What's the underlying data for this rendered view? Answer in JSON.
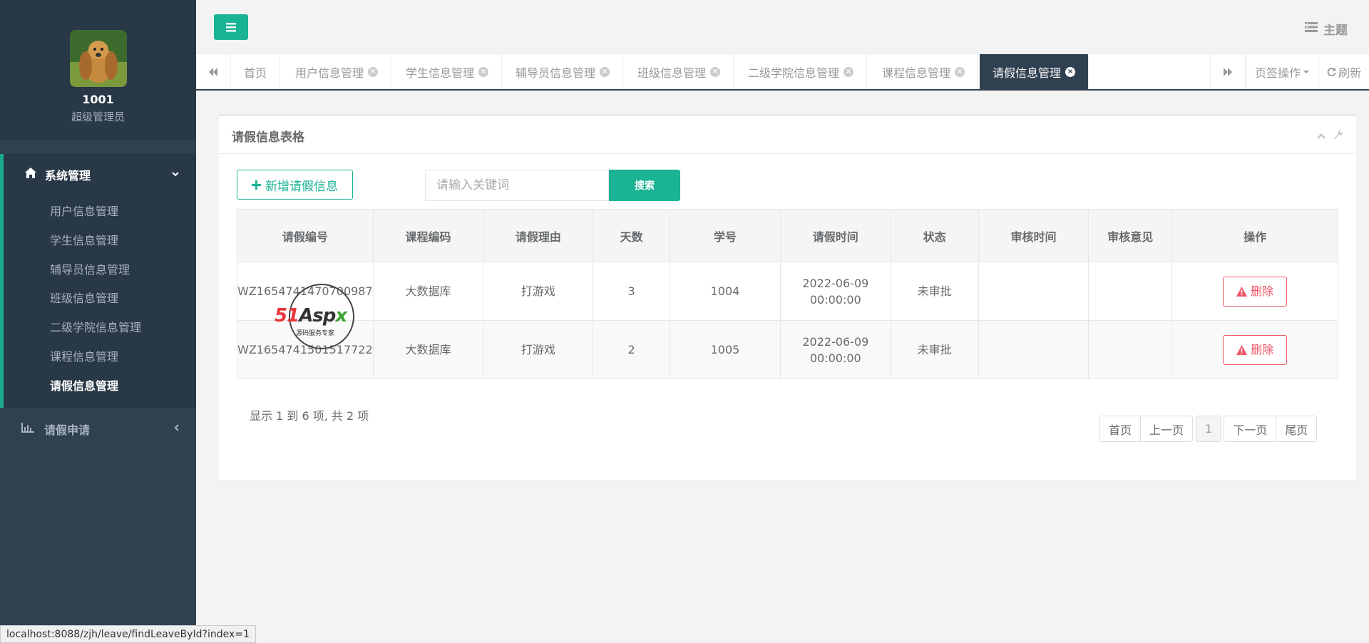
{
  "sidebar": {
    "profile": {
      "name": "1001",
      "role": "超级管理员"
    },
    "groups": [
      {
        "label": "系统管理",
        "icon": "home-icon",
        "items": [
          {
            "label": "用户信息管理"
          },
          {
            "label": "学生信息管理"
          },
          {
            "label": "辅导员信息管理"
          },
          {
            "label": "班级信息管理"
          },
          {
            "label": "二级学院信息管理"
          },
          {
            "label": "课程信息管理"
          },
          {
            "label": "请假信息管理",
            "active": true
          }
        ]
      },
      {
        "label": "请假申请",
        "icon": "bar-chart-icon"
      }
    ]
  },
  "topbar": {
    "theme_label": "主题"
  },
  "tabs": {
    "items": [
      {
        "label": "首页",
        "closable": false
      },
      {
        "label": "用户信息管理",
        "closable": true
      },
      {
        "label": "学生信息管理",
        "closable": true
      },
      {
        "label": "辅导员信息管理",
        "closable": true
      },
      {
        "label": "班级信息管理",
        "closable": true
      },
      {
        "label": "二级学院信息管理",
        "closable": true
      },
      {
        "label": "课程信息管理",
        "closable": true
      },
      {
        "label": "请假信息管理",
        "closable": true,
        "active": true
      }
    ],
    "page_ops_label": "页签操作",
    "refresh_label": "刷新"
  },
  "panel": {
    "title": "请假信息表格",
    "add_label": "新增请假信息",
    "search_placeholder": "请输入关键词",
    "search_label": "搜索"
  },
  "table": {
    "headers": [
      "请假编号",
      "课程编码",
      "请假理由",
      "天数",
      "学号",
      "请假时间",
      "状态",
      "审核时间",
      "审核意见",
      "操作"
    ],
    "rows": [
      {
        "id": "WZ1654741470700987",
        "course": "大数据库",
        "reason": "打游戏",
        "days": "3",
        "student": "1004",
        "date": "2022-06-09",
        "time": "00:00:00",
        "status": "未审批",
        "review_time": "",
        "review_note": "",
        "action": "删除"
      },
      {
        "id": "WZ1654741501517722",
        "course": "大数据库",
        "reason": "打游戏",
        "days": "2",
        "student": "1005",
        "date": "2022-06-09",
        "time": "00:00:00",
        "status": "未审批",
        "review_time": "",
        "review_note": "",
        "action": "删除"
      }
    ]
  },
  "pagination": {
    "info": "显示 1 到 6 项, 共 2 项",
    "first": "首页",
    "prev": "上一页",
    "current": "1",
    "next": "下一页",
    "last": "尾页"
  },
  "watermark": {
    "brand_red": "51",
    "brand_dark": "Asp",
    "brand_green": "x",
    "tagline": "源码服务专家"
  },
  "statusbar": {
    "url": "localhost:8088/zjh/leave/findLeaveById?index=1"
  },
  "colors": {
    "sidebar": "#2f4050",
    "accent": "#1ab394",
    "danger": "#ed5565"
  }
}
